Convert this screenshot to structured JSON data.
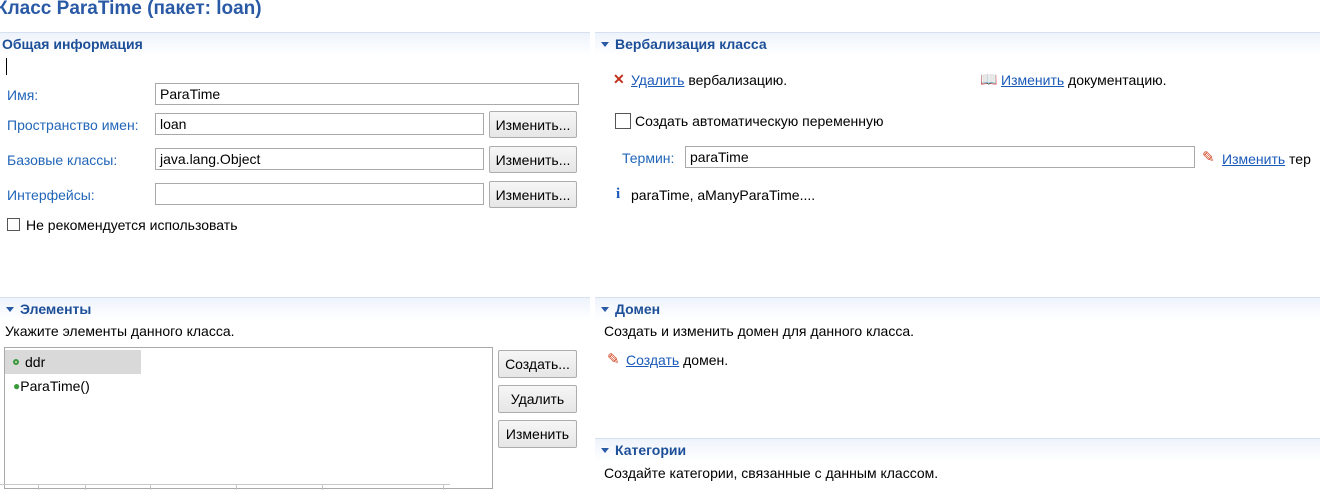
{
  "title": "Класс ParaTime (пакет: loan)",
  "general": {
    "header": "Общая информация",
    "name_label": "Имя:",
    "name_value": "ParaTime",
    "namespace_label": "Пространство имен:",
    "namespace_value": "loan",
    "base_label": "Базовые классы:",
    "base_value": "java.lang.Object",
    "interfaces_label": "Интерфейсы:",
    "interfaces_value": "",
    "change_button": "Изменить...",
    "deprecated_label": "Не рекомендуется использовать"
  },
  "verbalization": {
    "header": "Вербализация класса",
    "delete_link": "Удалить",
    "delete_suffix": "вербализацию.",
    "change_doc_link": "Изменить",
    "change_doc_suffix": "документацию.",
    "auto_var_label": "Создать автоматическую переменную",
    "term_label": "Термин:",
    "term_value": "paraTime",
    "change_term_link": "Изменить",
    "change_term_suffix": "тер",
    "info_text": "paraTime, aManyParaTime...."
  },
  "elements": {
    "header": "Элементы",
    "description": "Укажите элементы данного класса.",
    "items": [
      "ddr",
      "ParaTime()"
    ],
    "create_button": "Создать...",
    "delete_button": "Удалить",
    "change_button": "Изменить"
  },
  "domain": {
    "header": "Домен",
    "description": "Создать и изменить домен для данного класса.",
    "create_link": "Создать",
    "create_suffix": "домен."
  },
  "categories": {
    "header": "Категории",
    "description": "Создайте категории, связанные с данным классом."
  },
  "colors": {
    "header_text": "#1d4f98",
    "label_text": "#2266b8",
    "link": "#1a5ab8"
  },
  "icons": {
    "delete": "red-x-icon",
    "documentation": "book-icon",
    "edit": "pencil-icon",
    "info": "info-icon",
    "field": "field-dot-icon",
    "constructor": "constructor-icon"
  }
}
